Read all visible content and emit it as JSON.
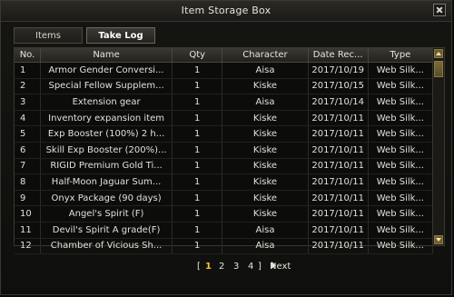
{
  "window": {
    "title": "Item Storage Box"
  },
  "tabs": [
    {
      "label": "Items"
    },
    {
      "label": "Take Log"
    }
  ],
  "table": {
    "headers": [
      "No.",
      "Name",
      "Qty",
      "Character",
      "Date Rec...",
      "Type"
    ],
    "rows": [
      {
        "no": "1",
        "name": "Armor Gender Conversi...",
        "qty": "1",
        "character": "Aisa",
        "date": "2017/10/19",
        "type": "Web Silk..."
      },
      {
        "no": "2",
        "name": "Special Fellow Supplem...",
        "qty": "1",
        "character": "Kiske",
        "date": "2017/10/15",
        "type": "Web Silk..."
      },
      {
        "no": "3",
        "name": "Extension gear",
        "qty": "1",
        "character": "Aisa",
        "date": "2017/10/14",
        "type": "Web Silk..."
      },
      {
        "no": "4",
        "name": "Inventory expansion item",
        "qty": "1",
        "character": "Kiske",
        "date": "2017/10/11",
        "type": "Web Silk..."
      },
      {
        "no": "5",
        "name": "Exp Booster (100%) 2 h...",
        "qty": "1",
        "character": "Kiske",
        "date": "2017/10/11",
        "type": "Web Silk..."
      },
      {
        "no": "6",
        "name": "Skill Exp Booster (200%)...",
        "qty": "1",
        "character": "Kiske",
        "date": "2017/10/11",
        "type": "Web Silk..."
      },
      {
        "no": "7",
        "name": "RIGID Premium Gold Ti...",
        "qty": "1",
        "character": "Kiske",
        "date": "2017/10/11",
        "type": "Web Silk..."
      },
      {
        "no": "8",
        "name": "Half-Moon Jaguar Sum...",
        "qty": "1",
        "character": "Kiske",
        "date": "2017/10/11",
        "type": "Web Silk..."
      },
      {
        "no": "9",
        "name": "Onyx Package (90 days)",
        "qty": "1",
        "character": "Kiske",
        "date": "2017/10/11",
        "type": "Web Silk..."
      },
      {
        "no": "10",
        "name": "Angel's Spirit (F)",
        "qty": "1",
        "character": "Kiske",
        "date": "2017/10/11",
        "type": "Web Silk..."
      },
      {
        "no": "11",
        "name": "Devil's Spirit A grade(F)",
        "qty": "1",
        "character": "Aisa",
        "date": "2017/10/11",
        "type": "Web Silk..."
      },
      {
        "no": "12",
        "name": "Chamber of Vicious Sh...",
        "qty": "1",
        "character": "Aisa",
        "date": "2017/10/11",
        "type": "Web Silk..."
      }
    ]
  },
  "pager": {
    "open_bracket": "[",
    "pages": [
      "1",
      "2",
      "3",
      "4"
    ],
    "current": "1",
    "close_bracket": "]",
    "next_label": "Next"
  },
  "icons": {
    "close": "close-icon",
    "next": "chevron-right-icon",
    "scroll_up": "scroll-up-icon",
    "scroll_down": "scroll-down-icon"
  }
}
